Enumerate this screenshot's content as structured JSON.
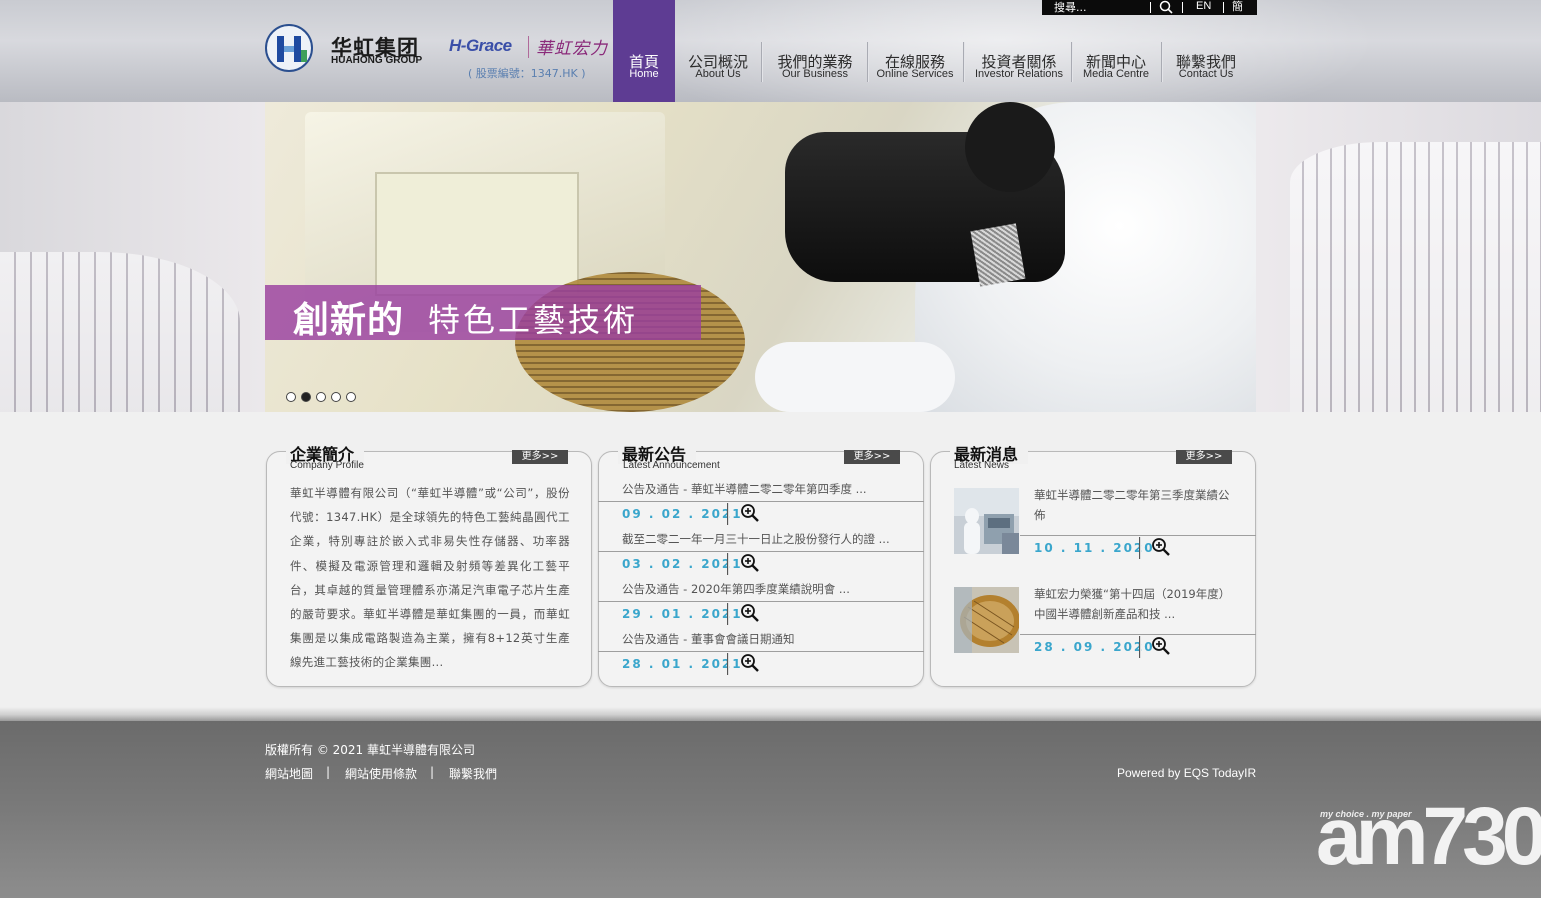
{
  "header": {
    "logo_cn": "华虹集团",
    "logo_en": "HUAHONG GROUP",
    "hgrace": "H-Grace",
    "hgrace_cn": "華虹宏力",
    "stock_code": "( 股票編號：1347.HK )"
  },
  "topbar": {
    "search_placeholder": "搜尋...",
    "lang_en": "EN",
    "lang_sc": "簡"
  },
  "nav": {
    "items": [
      {
        "zh": "首頁",
        "en": "Home",
        "active": true
      },
      {
        "zh": "公司概況",
        "en": "About Us"
      },
      {
        "zh": "我們的業務",
        "en": "Our Business"
      },
      {
        "zh": "在線服務",
        "en": "Online Services"
      },
      {
        "zh": "投資者關係",
        "en": "Investor Relations"
      },
      {
        "zh": "新聞中心",
        "en": "Media Centre"
      },
      {
        "zh": "聯繫我們",
        "en": "Contact Us"
      }
    ]
  },
  "banner": {
    "caption_strong": "創新的",
    "caption_light": "特色工藝技術",
    "dots_count": 5,
    "active_dot": 2
  },
  "profile": {
    "title": "企業簡介",
    "subtitle": "Company Profile",
    "more": "更多>>",
    "text": "華虹半導體有限公司（“華虹半導體”或“公司”，股份代號：1347.HK）是全球領先的特色工藝純晶圓代工企業，特別專註於嵌入式非易失性存儲器、功率器件、模擬及電源管理和邏輯及射頻等差異化工藝平台，其卓越的質量管理體系亦滿足汽車電子芯片生產的嚴苛要求。華虹半導體是華虹集團的一員，而華虹集團是以集成電路製造為主業，擁有8+12英寸生產線先進工藝技術的企業集團..."
  },
  "announcements": {
    "title": "最新公告",
    "subtitle": "Latest Announcement",
    "more": "更多>>",
    "items": [
      {
        "title": "公告及通告 - 華虹半導體二零二零年第四季度 ...",
        "date": "09 . 02 . 2021"
      },
      {
        "title": "截至二零二一年一月三十一日止之股份發行人的證 ...",
        "date": "03 . 02 . 2021"
      },
      {
        "title": "公告及通告 - 2020年第四季度業績說明會 ...",
        "date": "29 . 01 . 2021"
      },
      {
        "title": "公告及通告 - 董事會會議日期通知",
        "date": "28 . 01 . 2021"
      }
    ]
  },
  "news": {
    "title": "最新消息",
    "subtitle": "Latest News",
    "more": "更多>>",
    "items": [
      {
        "title": "華虹半導體二零二零年第三季度業績公佈",
        "date": "10 . 11 . 2020"
      },
      {
        "title": "華虹宏力榮獲“第十四屆（2019年度）中國半導體創新產品和技 ...",
        "date": "28 . 09 . 2020"
      }
    ]
  },
  "footer": {
    "copyright": "版權所有 © 2021 華虹半導體有限公司",
    "links": [
      "網站地圖",
      "網站使用條款",
      "聯繫我們"
    ],
    "separator": "|",
    "powered": "Powered by EQS TodayIR"
  },
  "watermark": {
    "tagline": "my choice . my paper",
    "brand": "am730"
  },
  "colors": {
    "nav_active": "#5e3c93",
    "caption_bg": "#9a40a0",
    "date_blue": "#3aa6cc"
  }
}
